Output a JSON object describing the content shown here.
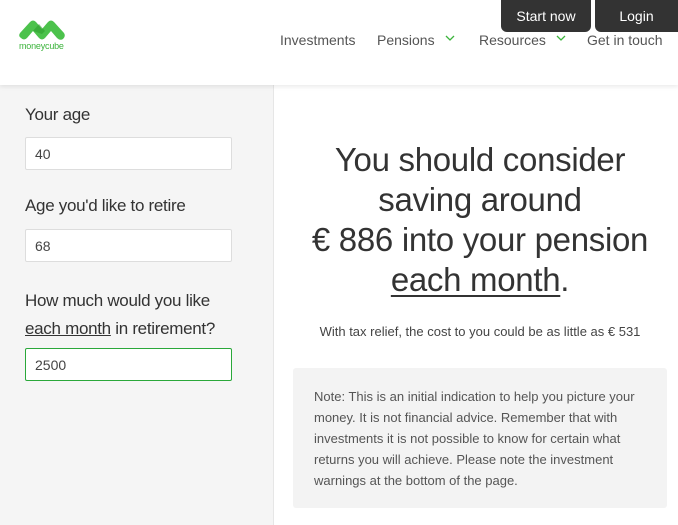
{
  "brand": {
    "name": "moneycube",
    "color": "#3cb43c"
  },
  "header": {
    "start_now_label": "Start now",
    "login_label": "Login",
    "nav": [
      {
        "label": "Investments",
        "has_dropdown": false
      },
      {
        "label": "Pensions",
        "has_dropdown": true
      },
      {
        "label": "Resources",
        "has_dropdown": true
      },
      {
        "label": "Get in touch",
        "has_dropdown": false
      }
    ]
  },
  "form": {
    "age_label": "Your age",
    "age_value": "40",
    "retire_label": "Age you'd like to retire",
    "retire_value": "68",
    "monthly_label_1": "How much would you like",
    "monthly_label_underlined": "each month",
    "monthly_label_2": " in retirement?",
    "monthly_value": "2500"
  },
  "result": {
    "line1": "You should consider saving around",
    "amount": "€ 886",
    "line2": " into your pension",
    "underlined": "each month",
    "end": ".",
    "tax_text": "With tax relief, the cost to you could be as little as € 531"
  },
  "note": {
    "text": "Note: This is an initial indication to help you picture your money. It is not financial advice. Remember that with investments it is not possible to know for certain what returns you will achieve. Please note the investment warnings at the bottom of the page."
  }
}
